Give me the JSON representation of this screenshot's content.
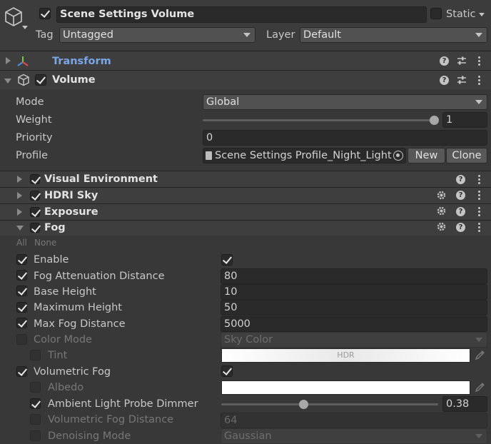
{
  "header": {
    "object_name": "Scene Settings Volume",
    "static_label": "Static",
    "tag_label": "Tag",
    "tag_value": "Untagged",
    "layer_label": "Layer",
    "layer_value": "Default"
  },
  "components": {
    "transform": {
      "title": "Transform"
    },
    "volume": {
      "title": "Volume",
      "mode_label": "Mode",
      "mode_value": "Global",
      "weight_label": "Weight",
      "weight_value": "1",
      "weight_fraction": 1.0,
      "priority_label": "Priority",
      "priority_value": "0",
      "profile_label": "Profile",
      "profile_value": "Scene Settings Profile_Night_Light",
      "new_button": "New",
      "clone_button": "Clone"
    }
  },
  "overrides": {
    "visual_environment": "Visual Environment",
    "hdri_sky": "HDRI Sky",
    "exposure": "Exposure",
    "fog": "Fog"
  },
  "fog": {
    "all_label": "All",
    "none_label": "None",
    "enable_label": "Enable",
    "fog_attenuation_label": "Fog Attenuation Distance",
    "fog_attenuation_value": "80",
    "base_height_label": "Base Height",
    "base_height_value": "10",
    "maximum_height_label": "Maximum Height",
    "maximum_height_value": "50",
    "max_fog_distance_label": "Max Fog Distance",
    "max_fog_distance_value": "5000",
    "color_mode_label": "Color Mode",
    "color_mode_value": "Sky Color",
    "tint_label": "Tint",
    "tint_hdr": "HDR",
    "volumetric_fog_label": "Volumetric Fog",
    "albedo_label": "Albedo",
    "ambient_probe_label": "Ambient Light Probe Dimmer",
    "ambient_probe_value": "0.38",
    "ambient_probe_fraction": 0.38,
    "vol_fog_distance_label": "Volumetric Fog Distance",
    "vol_fog_distance_value": "64",
    "denoising_mode_label": "Denoising Mode",
    "denoising_mode_value": "Gaussian"
  },
  "colors": {
    "accent_link": "#7aa6e6",
    "background": "#383838"
  }
}
